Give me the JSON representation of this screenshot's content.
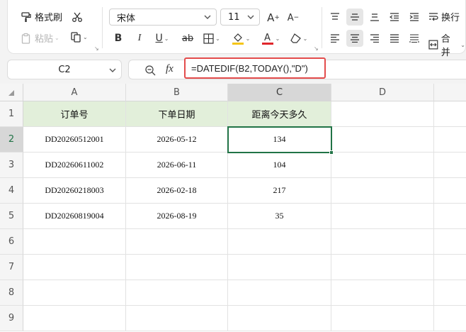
{
  "ribbon": {
    "format_painter": "格式刷",
    "paste": "粘贴",
    "font_name": "宋体",
    "font_size": "11",
    "wrap": "换行",
    "merge": "合并",
    "colors": {
      "highlight": "#f5c518",
      "font_color": "#e0262b"
    }
  },
  "formula_bar": {
    "name_box": "C2",
    "fx": "fx",
    "formula": "=DATEDIF(B2,TODAY(),\"D\")"
  },
  "sheet": {
    "columns": [
      "A",
      "B",
      "C",
      "D"
    ],
    "rows": [
      "1",
      "2",
      "3",
      "4",
      "5",
      "6",
      "7",
      "8",
      "9"
    ],
    "selected_cell": "C2",
    "header": [
      "订单号",
      "下单日期",
      "距离今天多久"
    ],
    "data": [
      [
        "DD20260512001",
        "2026-05-12",
        "134"
      ],
      [
        "DD20260611002",
        "2026-06-11",
        "104"
      ],
      [
        "DD20260218003",
        "2026-02-18",
        "217"
      ],
      [
        "DD20260819004",
        "2026-08-19",
        "35"
      ]
    ],
    "colors": {
      "header_fill": "#e2efda",
      "selection": "#217346"
    }
  }
}
